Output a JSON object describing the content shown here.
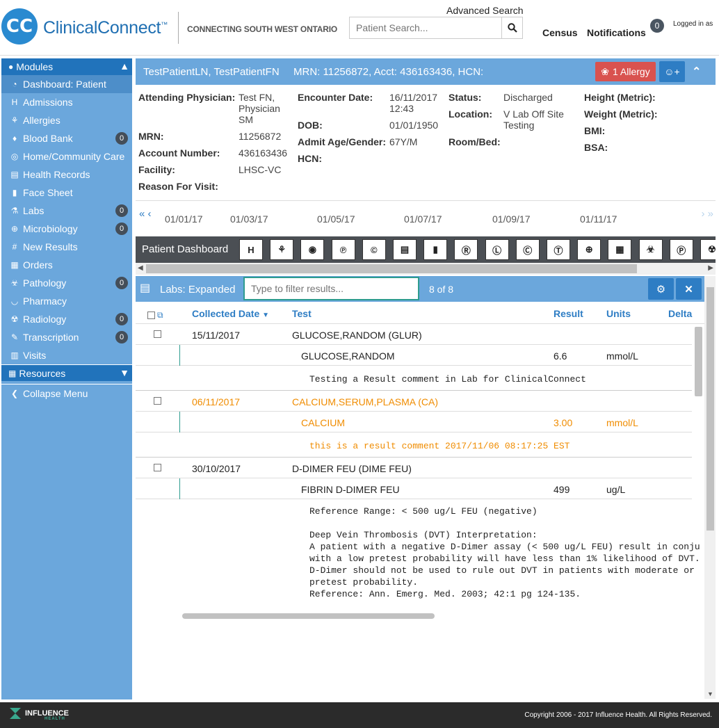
{
  "header": {
    "brand": "ClinicalConnect",
    "trademark": "™",
    "tagline": "CONNECTING SOUTH WEST ONTARIO",
    "advanced_search": "Advanced Search",
    "search_placeholder": "Patient Search...",
    "census": "Census",
    "notifications": "Notifications",
    "notification_count": "0",
    "logged_in": "Logged in as"
  },
  "sidebar": {
    "modules_label": "Modules",
    "items": [
      {
        "label": "Dashboard: Patient",
        "icon": "dashboard-icon",
        "badge": "",
        "active": true
      },
      {
        "label": "Admissions",
        "icon": "hospital-icon",
        "badge": ""
      },
      {
        "label": "Allergies",
        "icon": "allergy-icon",
        "badge": ""
      },
      {
        "label": "Blood Bank",
        "icon": "blood-drop-icon",
        "badge": "0"
      },
      {
        "label": "Home/Community Care",
        "icon": "community-care-icon",
        "badge": ""
      },
      {
        "label": "Health Records",
        "icon": "printer-icon",
        "badge": ""
      },
      {
        "label": "Face Sheet",
        "icon": "document-icon",
        "badge": ""
      },
      {
        "label": "Labs",
        "icon": "flask-icon",
        "badge": "0"
      },
      {
        "label": "Microbiology",
        "icon": "microscope-icon",
        "badge": "0"
      },
      {
        "label": "New Results",
        "icon": "hash-icon",
        "badge": ""
      },
      {
        "label": "Orders",
        "icon": "clipboard-icon",
        "badge": ""
      },
      {
        "label": "Pathology",
        "icon": "biohazard-icon",
        "badge": "0"
      },
      {
        "label": "Pharmacy",
        "icon": "mortar-icon",
        "badge": ""
      },
      {
        "label": "Radiology",
        "icon": "radiation-icon",
        "badge": "0"
      },
      {
        "label": "Transcription",
        "icon": "edit-icon",
        "badge": "0"
      },
      {
        "label": "Visits",
        "icon": "bar-chart-icon",
        "badge": ""
      }
    ],
    "resources_label": "Resources",
    "collapse_label": "Collapse Menu"
  },
  "patient": {
    "name": "TestPatientLN, TestPatientFN",
    "ids": "MRN: 11256872, Acct: 436163436, HCN:",
    "allergy_button": "1 Allergy"
  },
  "info": {
    "attending_label": "Attending Physician:",
    "attending_value": "Test FN, Physician SM",
    "mrn_label": "MRN:",
    "mrn_value": "11256872",
    "account_label": "Account Number:",
    "account_value": "436163436",
    "facility_label": "Facility:",
    "facility_value": "LHSC-VC",
    "reason_label": "Reason For Visit:",
    "encounter_label": "Encounter Date:",
    "encounter_value": "16/11/2017 12:43",
    "dob_label": "DOB:",
    "dob_value": "01/01/1950",
    "age_label": "Admit Age/Gender:",
    "age_value": "67Y/M",
    "hcn_label": "HCN:",
    "status_label": "Status:",
    "status_value": "Discharged",
    "location_label": "Location:",
    "location_value": "V Lab Off Site Testing",
    "room_label": "Room/Bed:",
    "height_label": "Height (Metric):",
    "weight_label": "Weight (Metric):",
    "bmi_label": "BMI:",
    "bsa_label": "BSA:"
  },
  "timeline": {
    "dates": [
      "01/01/17",
      "01/03/17",
      "01/05/17",
      "01/07/17",
      "01/09/17",
      "01/11/17"
    ]
  },
  "toolbar": {
    "label": "Patient Dashboard",
    "buttons": [
      "H",
      "⚘",
      "◉",
      "℗",
      "©",
      "▤",
      "▮",
      "Ⓡ",
      "Ⓛ",
      "Ⓒ",
      "Ⓣ",
      "⊕",
      "▦",
      "☣",
      "Ⓟ",
      "☢"
    ]
  },
  "labs": {
    "title": "Labs: Expanded",
    "filter_placeholder": "Type to filter results...",
    "count": "8 of 8",
    "columns": {
      "collected": "Collected Date",
      "test": "Test",
      "result": "Result",
      "units": "Units",
      "delta": "Delta"
    },
    "rows": [
      {
        "date": "15/11/2017",
        "test": "GLUCOSE,RANDOM (GLUR)",
        "sub_test": "GLUCOSE,RANDOM",
        "result": "6.6",
        "units": "mmol/L",
        "comment": "Testing a Result comment in Lab for ClinicalConnect"
      },
      {
        "date": "06/11/2017",
        "test": "CALCIUM,SERUM,PLASMA (CA)",
        "sub_test": "CALCIUM",
        "result": "3.00",
        "units": "mmol/L",
        "comment": "this is a result comment 2017/11/06 08:17:25 EST"
      },
      {
        "date": "30/10/2017",
        "test": "D-DIMER FEU (DIME FEU)",
        "sub_test": "FIBRIN D-DIMER FEU",
        "result": "499",
        "units": "ug/L",
        "comment": "Reference Range: < 500 ug/L FEU (negative)\n\nDeep Vein Thrombosis (DVT) Interpretation:\nA patient with a negative D-Dimer assay (< 500 ug/L FEU) result in conju\nwith a low pretest probability will have less than 1% likelihood of DVT.\nD-Dimer should not be used to rule out DVT in patients with moderate or\npretest probability.\nReference: Ann. Emerg. Med. 2003; 42:1 pg 124-135."
      }
    ]
  },
  "footer": {
    "logo": "INFLUENCE",
    "logo_sub": "HEALTH",
    "copyright": "Copyright 2006 - 2017 Influence Health. All Rights Reserved."
  },
  "colors": {
    "accent": "#2e7dc4",
    "sidebar": "#6ba7dc",
    "allergy": "#d9524f",
    "abnormal": "#f08c00",
    "divider": "#2e9c8f"
  }
}
